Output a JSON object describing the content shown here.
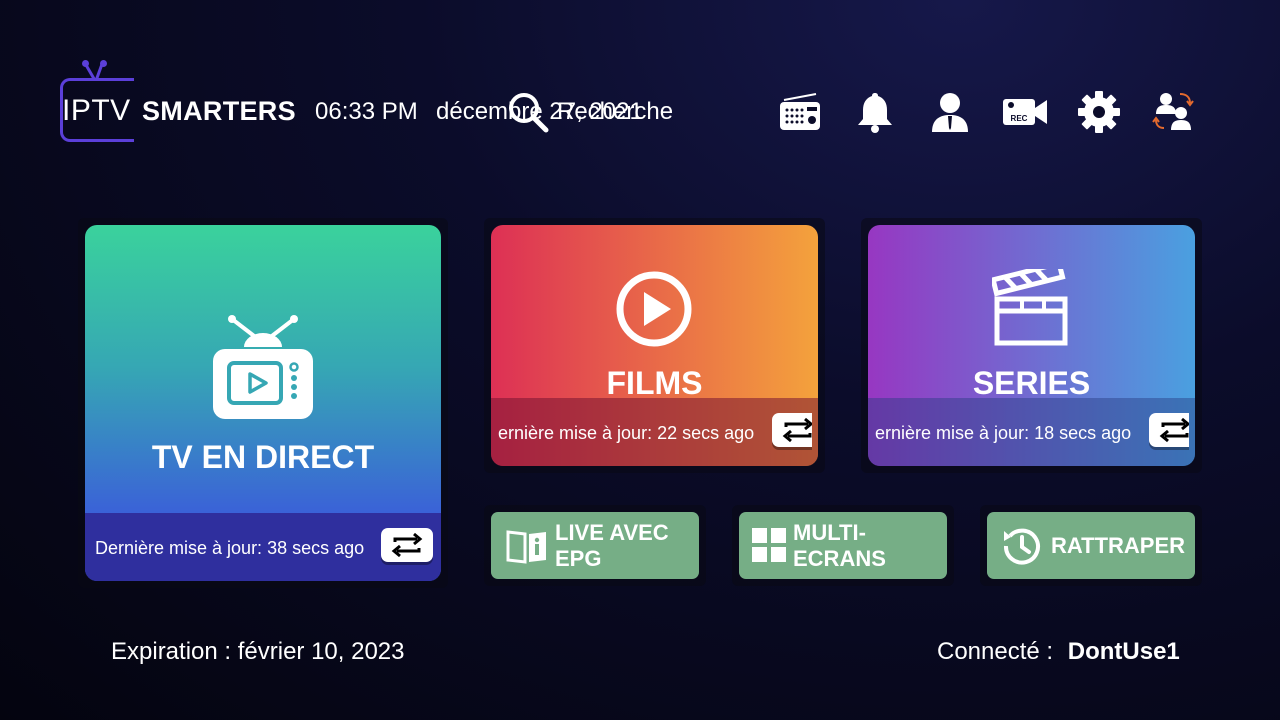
{
  "header": {
    "logo_left": "IPTV",
    "logo_right": "SMARTERS",
    "time": "06:33 PM",
    "date": "décembre 27, 2021",
    "search_label": "Recherche",
    "icons": [
      "radio-icon",
      "bell-icon",
      "user-icon",
      "rec-camera-icon",
      "gear-icon",
      "switch-users-icon"
    ]
  },
  "tiles": {
    "live": {
      "title": "TV EN DIRECT",
      "updated": "Dernière mise à jour: 38 secs ago",
      "gradient": [
        "#3ad29c",
        "#3b5bdb",
        "#2f2f9e"
      ]
    },
    "films": {
      "title": "FILMS",
      "updated": "ernière mise à jour: 22 secs ago",
      "gradient": [
        "#dd3055",
        "#f4a23c"
      ]
    },
    "series": {
      "title": "SERIES",
      "updated": "ernière mise à jour: 18 secs ago",
      "gradient": [
        "#9737c2",
        "#4aa0e0"
      ]
    }
  },
  "small_tiles": {
    "epg": "LIVE AVEC EPG",
    "multi": "MULTI-ECRANS",
    "catchup": "RATTRAPER",
    "color": "#76ae86"
  },
  "footer": {
    "expiration": "Expiration : février 10, 2023",
    "connected_label": "Connecté :",
    "username": "DontUse1"
  }
}
